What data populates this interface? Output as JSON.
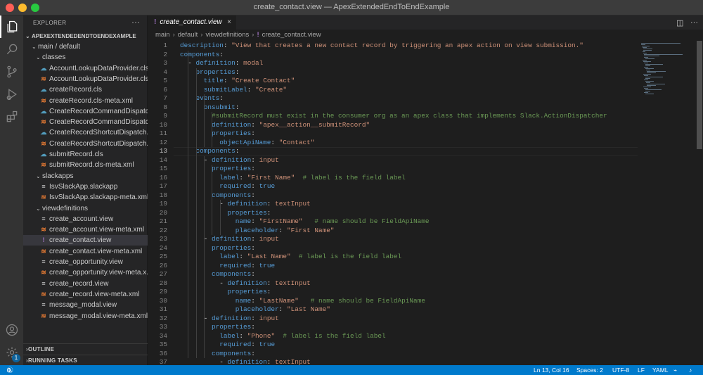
{
  "window": {
    "title": "create_contact.view — ApexExtendedEndToEndExample"
  },
  "colors": {
    "accent": "#007acc",
    "editor_bg": "#1e1e1e",
    "sidebar_bg": "#252526",
    "activity_bg": "#333333"
  },
  "activity_bar": {
    "top": [
      "files-icon",
      "search-icon",
      "source-control-icon",
      "run-debug-icon",
      "extensions-icon"
    ],
    "bottom": [
      "account-icon",
      "settings-gear-icon"
    ],
    "settings_badge": "1"
  },
  "explorer": {
    "title": "EXPLORER",
    "more": "···",
    "project": "APEXEXTENDEDENDTOENDEXAMPLE",
    "tree": [
      {
        "label": "main / default",
        "type": "folder",
        "depth": 1
      },
      {
        "label": "classes",
        "type": "folder",
        "depth": 2
      },
      {
        "label": "AccountLookupDataProvider.cls",
        "type": "cls",
        "depth": 3
      },
      {
        "label": "AccountLookupDataProvider.cls...",
        "type": "xml",
        "depth": 3
      },
      {
        "label": "createRecord.cls",
        "type": "cls",
        "depth": 3
      },
      {
        "label": "createRecord.cls-meta.xml",
        "type": "xml",
        "depth": 3
      },
      {
        "label": "CreateRecordCommandDispatch...",
        "type": "cls",
        "depth": 3
      },
      {
        "label": "CreateRecordCommandDispatc...",
        "type": "xml",
        "depth": 3
      },
      {
        "label": "CreateRecordShortcutDispatch...",
        "type": "cls",
        "depth": 3
      },
      {
        "label": "CreateRecordShortcutDispatch...",
        "type": "xml",
        "depth": 3
      },
      {
        "label": "submitRecord.cls",
        "type": "cls",
        "depth": 3
      },
      {
        "label": "submitRecord.cls-meta.xml",
        "type": "xml",
        "depth": 3
      },
      {
        "label": "slackapps",
        "type": "folder",
        "depth": 2
      },
      {
        "label": "IsvSlackApp.slackapp",
        "type": "plain",
        "depth": 3
      },
      {
        "label": "IsvSlackApp.slackapp-meta.xml",
        "type": "xml",
        "depth": 3
      },
      {
        "label": "viewdefinitions",
        "type": "folder",
        "depth": 2
      },
      {
        "label": "create_account.view",
        "type": "plain",
        "depth": 3
      },
      {
        "label": "create_account.view-meta.xml",
        "type": "xml",
        "depth": 3
      },
      {
        "label": "create_contact.view",
        "type": "view",
        "depth": 3,
        "selected": true
      },
      {
        "label": "create_contact.view-meta.xml",
        "type": "xml",
        "depth": 3
      },
      {
        "label": "create_opportunity.view",
        "type": "plain",
        "depth": 3
      },
      {
        "label": "create_opportunity.view-meta.x...",
        "type": "xml",
        "depth": 3
      },
      {
        "label": "create_record.view",
        "type": "plain",
        "depth": 3
      },
      {
        "label": "create_record.view-meta.xml",
        "type": "xml",
        "depth": 3
      },
      {
        "label": "message_modal.view",
        "type": "plain",
        "depth": 3
      },
      {
        "label": "message_modal.view-meta.xml",
        "type": "xml",
        "depth": 3
      }
    ],
    "sections": [
      "OUTLINE",
      "RUNNING TASKS"
    ]
  },
  "tab": {
    "label": "create_contact.view",
    "icon": "!",
    "close": "×"
  },
  "editor_actions": [
    "split-editor-icon",
    "more-actions-icon"
  ],
  "breadcrumb": [
    "main",
    "default",
    "viewdefinitions",
    "create_contact.view"
  ],
  "editor": {
    "current_line": 13,
    "start_line": 1,
    "lines": [
      "description: \"View that creates a new contact record by triggering an apex action on view submission.\"",
      "components:",
      "  - definition: modal",
      "    properties:",
      "      title: \"Create Contact\"",
      "      submitLabel: \"Create\"",
      "    events:",
      "      onsubmit:",
      "        #submitRecord must exist in the consumer org as an apex class that implements Slack.ActionDispatcher",
      "        definition: \"apex__action__submitRecord\"",
      "        properties:",
      "          objectApiName: \"Contact\"",
      "    components:",
      "      - definition: input",
      "        properties:",
      "          label: \"First Name\"  # label is the field label",
      "          required: true",
      "        components:",
      "          - definition: textInput",
      "            properties:",
      "              name: \"FirstName\"   # name should be FieldApiName",
      "              placeholder: \"First Name\"",
      "      - definition: input",
      "        properties:",
      "          label: \"Last Name\"  # label is the field label",
      "          required: true",
      "        components:",
      "          - definition: textInput",
      "            properties:",
      "              name: \"LastName\"   # name should be FieldApiName",
      "              placeholder: \"Last Name\"",
      "      - definition: input",
      "        properties:",
      "          label: \"Phone\"  # label is the field label",
      "          required: true",
      "        components:",
      "          - definition: textInput"
    ]
  },
  "status": {
    "errors": "0",
    "warnings": "0",
    "position": "Ln 13, Col 16",
    "spaces": "Spaces: 2",
    "encoding": "UTF-8",
    "eol": "LF",
    "language": "YAML"
  }
}
